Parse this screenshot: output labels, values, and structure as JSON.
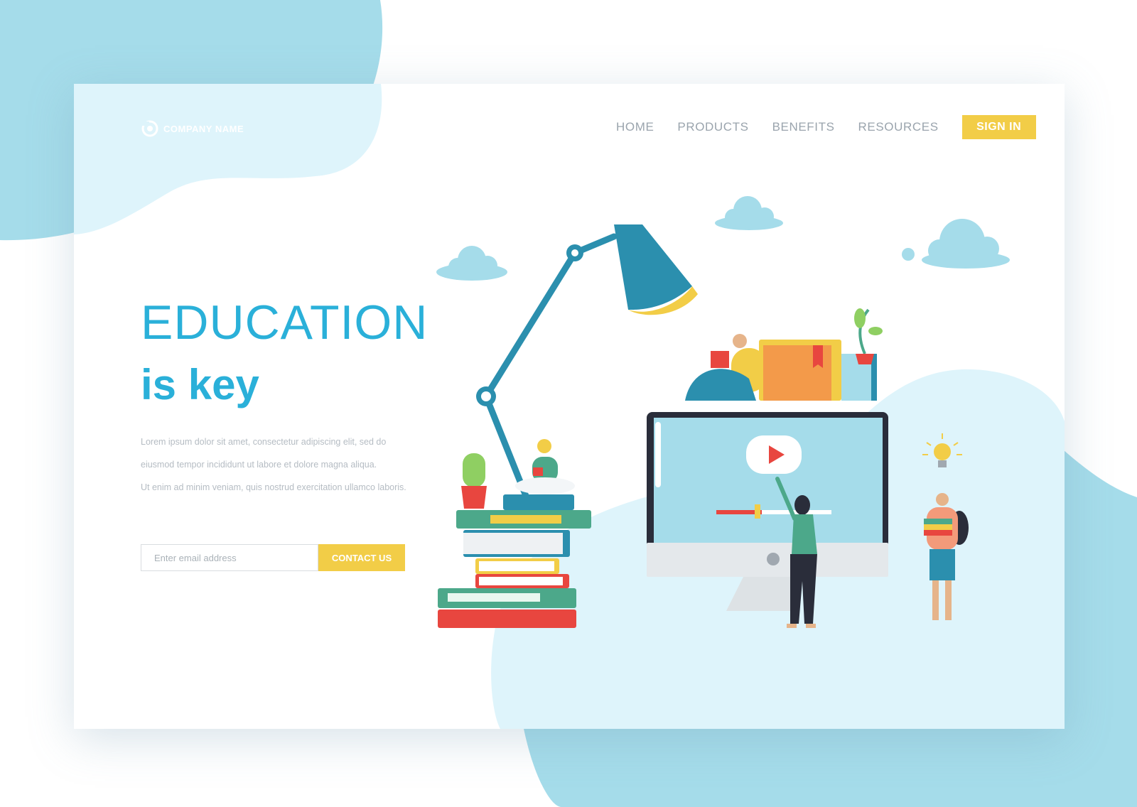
{
  "brand": {
    "name": "COMPANY NAME",
    "icon": "logo-swirl-icon"
  },
  "nav": {
    "items": [
      {
        "label": "HOME"
      },
      {
        "label": "PRODUCTS"
      },
      {
        "label": "BENEFITS"
      },
      {
        "label": "RESOURCES"
      }
    ],
    "sign_in_label": "SIGN IN"
  },
  "hero": {
    "title": "EDUCATION",
    "subtitle": "is key",
    "paragraph": [
      "Lorem ipsum dolor sit amet, consectetur adipiscing elit, sed do",
      "eiusmod tempor incididunt ut labore et dolore magna aliqua.",
      "Ut enim ad minim veniam, quis nostrud exercitation ullamco laboris."
    ]
  },
  "signup": {
    "email_placeholder": "Enter email address",
    "contact_label": "CONTACT US"
  },
  "colors": {
    "accent": "#2ab0d9",
    "button": "#f2cd47",
    "blob_light": "#def4fb",
    "blob_dark": "#a5dcea",
    "lamp": "#2b8fae"
  },
  "icons": [
    "lamp-icon",
    "cloud-icon",
    "books-stack-icon",
    "monitor-icon",
    "play-icon",
    "lightbulb-icon",
    "cactus-icon",
    "plant-icon"
  ]
}
